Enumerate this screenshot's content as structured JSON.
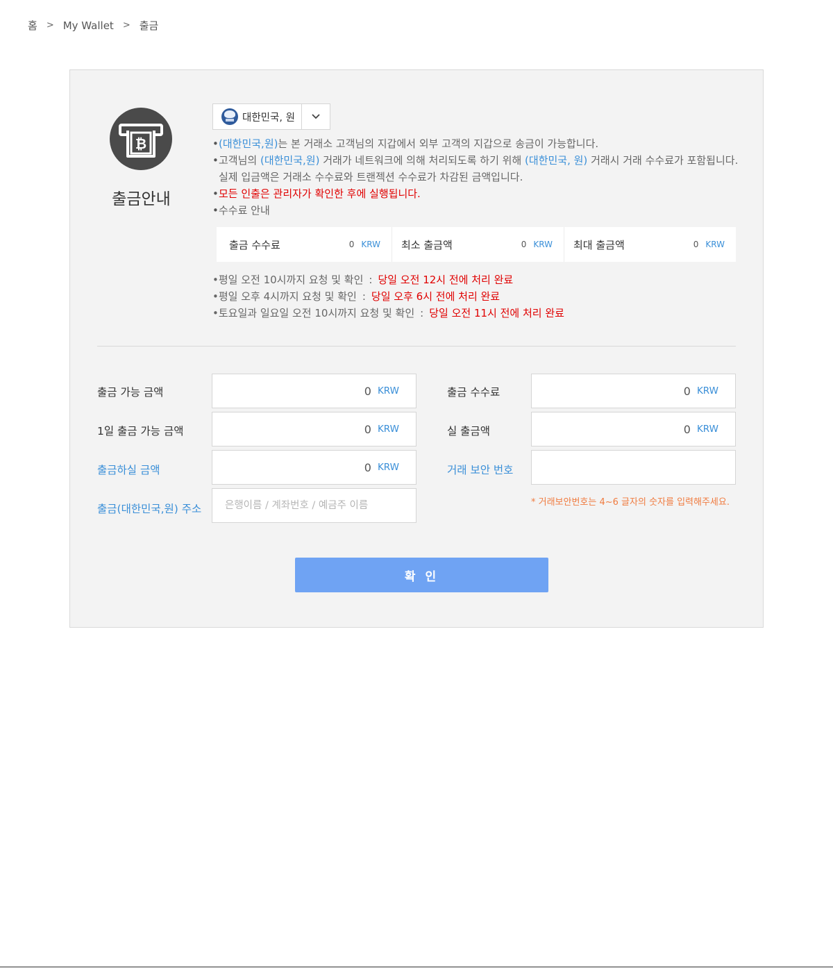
{
  "breadcrumb": {
    "home": "홈",
    "sep1": ">",
    "wallet": "My Wallet",
    "sep2": ">",
    "current": "출금"
  },
  "guide": {
    "title": "출금안내",
    "icon": "atm-bitcoin-icon"
  },
  "currency": {
    "selected": "대한민국, 원",
    "flag_icon": "currency-flag-icon",
    "caret_icon": "chevron-down-icon"
  },
  "notes": {
    "line1_hl": "(대한민국,원)",
    "line1_rest": "는 본 거래소 고객님의 지갑에서 외부 고객의 지갑으로 송금이 가능합니다.",
    "line2_a": "고객님의 ",
    "line2_hl1": "(대한민국,원)",
    "line2_b": " 거래가 네트워크에 의해 처리되도록 하기 위해 ",
    "line2_hl2": "(대한민국, 원)",
    "line2_c": " 거래시 거래 수수료가 포함됩니다.",
    "line3": "실제 입금액은 거래소 수수료와 트랜젝션 수수료가 차감된 금액입니다.",
    "line4": "모든 인출은 관리자가 확인한 후에 실행됩니다.",
    "line5": "수수료 안내",
    "bullet": "•"
  },
  "fees": [
    {
      "label": "출금 수수료",
      "value": "0",
      "unit": "KRW"
    },
    {
      "label": "최소 출금액",
      "value": "0",
      "unit": "KRW"
    },
    {
      "label": "최대 출금액",
      "value": "0",
      "unit": "KRW"
    }
  ],
  "schedule": [
    {
      "condition": "평일 오전 10시까지 요청 및 확인",
      "colon": ":",
      "result": "당일 오전 12시 전에 처리 완료"
    },
    {
      "condition": "평일 오후 4시까지 요청 및 확인",
      "colon": ":",
      "result": "당일 오후 6시 전에 처리 완료"
    },
    {
      "condition": "토요일과 일요일 오전 10시까지 요청 및 확인",
      "colon": ":",
      "result": "당일 오전 11시 전에 처리 완료"
    }
  ],
  "form": {
    "available": {
      "label": "출금 가능 금액",
      "value": "0",
      "unit": "KRW"
    },
    "daily_available": {
      "label": "1일 출금 가능 금액",
      "value": "0",
      "unit": "KRW"
    },
    "amount": {
      "label": "출금하실 금액",
      "value": "0",
      "unit": "KRW"
    },
    "address": {
      "label": "출금(대한민국,원) 주소",
      "value": "",
      "placeholder": "은행이름 / 계좌번호 / 예금주 이름"
    },
    "fee": {
      "label": "출금 수수료",
      "value": "0",
      "unit": "KRW"
    },
    "actual": {
      "label": "실 출금액",
      "value": "0",
      "unit": "KRW"
    },
    "security": {
      "label": "거래 보안 번호",
      "value": ""
    },
    "security_hint": "* 거래보안번호는 4~6 글자의 숫자를 입력해주세요."
  },
  "confirm_label": "확 인"
}
